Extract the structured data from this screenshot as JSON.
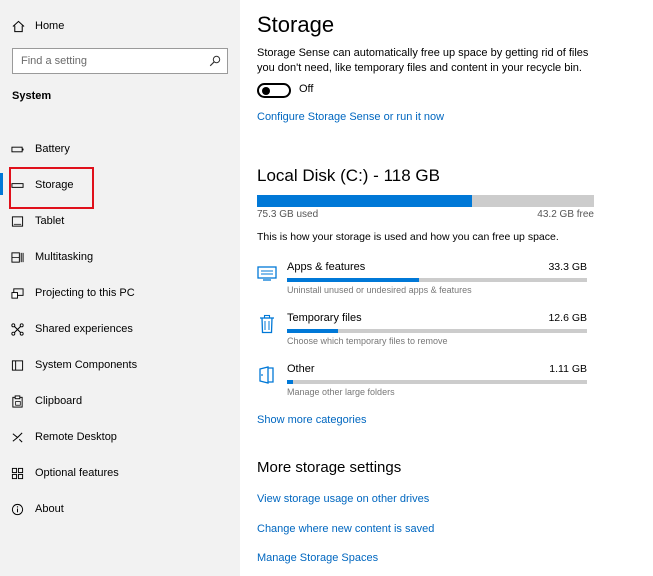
{
  "sidebar": {
    "home_label": "Home",
    "search_placeholder": "Find a setting",
    "section_title": "System",
    "items": [
      {
        "label": "Battery",
        "icon": "battery-icon"
      },
      {
        "label": "Storage",
        "icon": "storage-icon"
      },
      {
        "label": "Tablet",
        "icon": "tablet-icon"
      },
      {
        "label": "Multitasking",
        "icon": "multitasking-icon"
      },
      {
        "label": "Projecting to this PC",
        "icon": "projecting-icon"
      },
      {
        "label": "Shared experiences",
        "icon": "shared-experiences-icon"
      },
      {
        "label": "System Components",
        "icon": "system-components-icon"
      },
      {
        "label": "Clipboard",
        "icon": "clipboard-icon"
      },
      {
        "label": "Remote Desktop",
        "icon": "remote-desktop-icon"
      },
      {
        "label": "Optional features",
        "icon": "optional-features-icon"
      },
      {
        "label": "About",
        "icon": "about-icon"
      }
    ],
    "selected_item": "Storage"
  },
  "main": {
    "title": "Storage",
    "description": "Storage Sense can automatically free up space by getting rid of files you don't need, like temporary files and content in your recycle bin.",
    "toggle_label": "Off",
    "toggle_on": false,
    "configure_link": "Configure Storage Sense or run it now",
    "disk": {
      "title": "Local Disk (C:) - 118 GB",
      "used": "75.3 GB used",
      "free": "43.2 GB free",
      "used_fraction": 0.638
    },
    "info": "This is how your storage is used and how you can free up space.",
    "categories": [
      {
        "name": "Apps & features",
        "size": "33.3 GB",
        "sub": "Uninstall unused or undesired apps & features",
        "fraction": 0.44,
        "icon": "apps-icon"
      },
      {
        "name": "Temporary files",
        "size": "12.6 GB",
        "sub": "Choose which temporary files to remove",
        "fraction": 0.17,
        "icon": "trash-icon"
      },
      {
        "name": "Other",
        "size": "1.11 GB",
        "sub": "Manage other large folders",
        "fraction": 0.02,
        "icon": "folder-icon"
      }
    ],
    "show_more_link": "Show more categories",
    "more_settings_title": "More storage settings",
    "more_links": [
      "View storage usage on other drives",
      "Change where new content is saved",
      "Manage Storage Spaces"
    ]
  },
  "colors": {
    "accent": "#0078d7",
    "link": "#0067c0",
    "highlight_box": "#e0101b"
  }
}
